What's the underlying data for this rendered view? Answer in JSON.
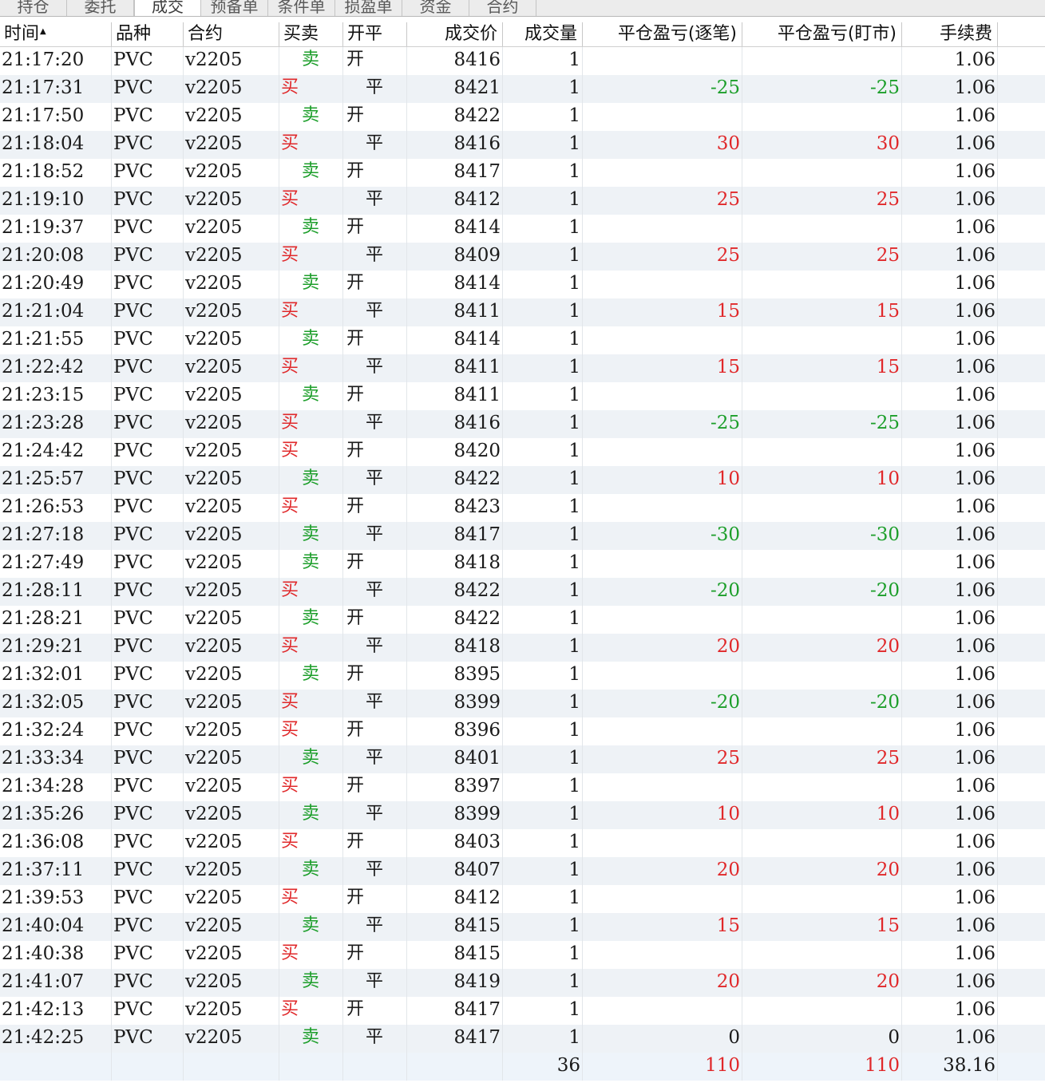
{
  "colors": {
    "buy": "#e0282a",
    "sell": "#1c9e2a",
    "profit": "#e0282a",
    "loss": "#1c9e2a",
    "row_alt": "#eef2f6"
  },
  "tabs": [
    "持仓",
    "委托",
    "成交",
    "预备单",
    "条件单",
    "损盈单",
    "资金",
    "合约"
  ],
  "active_tab": "成交",
  "sort_indicator": "▲",
  "columns": [
    "时间",
    "品种",
    "合约",
    "买卖",
    "开平",
    "成交价",
    "成交量",
    "平仓盈亏(逐笔)",
    "平仓盈亏(盯市)",
    "手续费"
  ],
  "rows": [
    {
      "time": "21:17:20",
      "product": "PVC",
      "contract": "v2205",
      "side": "卖",
      "oc": "开",
      "price": "8416",
      "qty": "1",
      "pnl_trade": "",
      "pnl_mark": "",
      "fee": "1.06"
    },
    {
      "time": "21:17:31",
      "product": "PVC",
      "contract": "v2205",
      "side": "买",
      "oc": "平",
      "price": "8421",
      "qty": "1",
      "pnl_trade": "-25",
      "pnl_mark": "-25",
      "fee": "1.06"
    },
    {
      "time": "21:17:50",
      "product": "PVC",
      "contract": "v2205",
      "side": "卖",
      "oc": "开",
      "price": "8422",
      "qty": "1",
      "pnl_trade": "",
      "pnl_mark": "",
      "fee": "1.06"
    },
    {
      "time": "21:18:04",
      "product": "PVC",
      "contract": "v2205",
      "side": "买",
      "oc": "平",
      "price": "8416",
      "qty": "1",
      "pnl_trade": "30",
      "pnl_mark": "30",
      "fee": "1.06"
    },
    {
      "time": "21:18:52",
      "product": "PVC",
      "contract": "v2205",
      "side": "卖",
      "oc": "开",
      "price": "8417",
      "qty": "1",
      "pnl_trade": "",
      "pnl_mark": "",
      "fee": "1.06"
    },
    {
      "time": "21:19:10",
      "product": "PVC",
      "contract": "v2205",
      "side": "买",
      "oc": "平",
      "price": "8412",
      "qty": "1",
      "pnl_trade": "25",
      "pnl_mark": "25",
      "fee": "1.06"
    },
    {
      "time": "21:19:37",
      "product": "PVC",
      "contract": "v2205",
      "side": "卖",
      "oc": "开",
      "price": "8414",
      "qty": "1",
      "pnl_trade": "",
      "pnl_mark": "",
      "fee": "1.06"
    },
    {
      "time": "21:20:08",
      "product": "PVC",
      "contract": "v2205",
      "side": "买",
      "oc": "平",
      "price": "8409",
      "qty": "1",
      "pnl_trade": "25",
      "pnl_mark": "25",
      "fee": "1.06"
    },
    {
      "time": "21:20:49",
      "product": "PVC",
      "contract": "v2205",
      "side": "卖",
      "oc": "开",
      "price": "8414",
      "qty": "1",
      "pnl_trade": "",
      "pnl_mark": "",
      "fee": "1.06"
    },
    {
      "time": "21:21:04",
      "product": "PVC",
      "contract": "v2205",
      "side": "买",
      "oc": "平",
      "price": "8411",
      "qty": "1",
      "pnl_trade": "15",
      "pnl_mark": "15",
      "fee": "1.06"
    },
    {
      "time": "21:21:55",
      "product": "PVC",
      "contract": "v2205",
      "side": "卖",
      "oc": "开",
      "price": "8414",
      "qty": "1",
      "pnl_trade": "",
      "pnl_mark": "",
      "fee": "1.06"
    },
    {
      "time": "21:22:42",
      "product": "PVC",
      "contract": "v2205",
      "side": "买",
      "oc": "平",
      "price": "8411",
      "qty": "1",
      "pnl_trade": "15",
      "pnl_mark": "15",
      "fee": "1.06"
    },
    {
      "time": "21:23:15",
      "product": "PVC",
      "contract": "v2205",
      "side": "卖",
      "oc": "开",
      "price": "8411",
      "qty": "1",
      "pnl_trade": "",
      "pnl_mark": "",
      "fee": "1.06"
    },
    {
      "time": "21:23:28",
      "product": "PVC",
      "contract": "v2205",
      "side": "买",
      "oc": "平",
      "price": "8416",
      "qty": "1",
      "pnl_trade": "-25",
      "pnl_mark": "-25",
      "fee": "1.06"
    },
    {
      "time": "21:24:42",
      "product": "PVC",
      "contract": "v2205",
      "side": "买",
      "oc": "开",
      "price": "8420",
      "qty": "1",
      "pnl_trade": "",
      "pnl_mark": "",
      "fee": "1.06"
    },
    {
      "time": "21:25:57",
      "product": "PVC",
      "contract": "v2205",
      "side": "卖",
      "oc": "平",
      "price": "8422",
      "qty": "1",
      "pnl_trade": "10",
      "pnl_mark": "10",
      "fee": "1.06"
    },
    {
      "time": "21:26:53",
      "product": "PVC",
      "contract": "v2205",
      "side": "买",
      "oc": "开",
      "price": "8423",
      "qty": "1",
      "pnl_trade": "",
      "pnl_mark": "",
      "fee": "1.06"
    },
    {
      "time": "21:27:18",
      "product": "PVC",
      "contract": "v2205",
      "side": "卖",
      "oc": "平",
      "price": "8417",
      "qty": "1",
      "pnl_trade": "-30",
      "pnl_mark": "-30",
      "fee": "1.06"
    },
    {
      "time": "21:27:49",
      "product": "PVC",
      "contract": "v2205",
      "side": "卖",
      "oc": "开",
      "price": "8418",
      "qty": "1",
      "pnl_trade": "",
      "pnl_mark": "",
      "fee": "1.06"
    },
    {
      "time": "21:28:11",
      "product": "PVC",
      "contract": "v2205",
      "side": "买",
      "oc": "平",
      "price": "8422",
      "qty": "1",
      "pnl_trade": "-20",
      "pnl_mark": "-20",
      "fee": "1.06"
    },
    {
      "time": "21:28:21",
      "product": "PVC",
      "contract": "v2205",
      "side": "卖",
      "oc": "开",
      "price": "8422",
      "qty": "1",
      "pnl_trade": "",
      "pnl_mark": "",
      "fee": "1.06"
    },
    {
      "time": "21:29:21",
      "product": "PVC",
      "contract": "v2205",
      "side": "买",
      "oc": "平",
      "price": "8418",
      "qty": "1",
      "pnl_trade": "20",
      "pnl_mark": "20",
      "fee": "1.06"
    },
    {
      "time": "21:32:01",
      "product": "PVC",
      "contract": "v2205",
      "side": "卖",
      "oc": "开",
      "price": "8395",
      "qty": "1",
      "pnl_trade": "",
      "pnl_mark": "",
      "fee": "1.06"
    },
    {
      "time": "21:32:05",
      "product": "PVC",
      "contract": "v2205",
      "side": "买",
      "oc": "平",
      "price": "8399",
      "qty": "1",
      "pnl_trade": "-20",
      "pnl_mark": "-20",
      "fee": "1.06"
    },
    {
      "time": "21:32:24",
      "product": "PVC",
      "contract": "v2205",
      "side": "买",
      "oc": "开",
      "price": "8396",
      "qty": "1",
      "pnl_trade": "",
      "pnl_mark": "",
      "fee": "1.06"
    },
    {
      "time": "21:33:34",
      "product": "PVC",
      "contract": "v2205",
      "side": "卖",
      "oc": "平",
      "price": "8401",
      "qty": "1",
      "pnl_trade": "25",
      "pnl_mark": "25",
      "fee": "1.06"
    },
    {
      "time": "21:34:28",
      "product": "PVC",
      "contract": "v2205",
      "side": "买",
      "oc": "开",
      "price": "8397",
      "qty": "1",
      "pnl_trade": "",
      "pnl_mark": "",
      "fee": "1.06"
    },
    {
      "time": "21:35:26",
      "product": "PVC",
      "contract": "v2205",
      "side": "卖",
      "oc": "平",
      "price": "8399",
      "qty": "1",
      "pnl_trade": "10",
      "pnl_mark": "10",
      "fee": "1.06"
    },
    {
      "time": "21:36:08",
      "product": "PVC",
      "contract": "v2205",
      "side": "买",
      "oc": "开",
      "price": "8403",
      "qty": "1",
      "pnl_trade": "",
      "pnl_mark": "",
      "fee": "1.06"
    },
    {
      "time": "21:37:11",
      "product": "PVC",
      "contract": "v2205",
      "side": "卖",
      "oc": "平",
      "price": "8407",
      "qty": "1",
      "pnl_trade": "20",
      "pnl_mark": "20",
      "fee": "1.06"
    },
    {
      "time": "21:39:53",
      "product": "PVC",
      "contract": "v2205",
      "side": "买",
      "oc": "开",
      "price": "8412",
      "qty": "1",
      "pnl_trade": "",
      "pnl_mark": "",
      "fee": "1.06"
    },
    {
      "time": "21:40:04",
      "product": "PVC",
      "contract": "v2205",
      "side": "卖",
      "oc": "平",
      "price": "8415",
      "qty": "1",
      "pnl_trade": "15",
      "pnl_mark": "15",
      "fee": "1.06"
    },
    {
      "time": "21:40:38",
      "product": "PVC",
      "contract": "v2205",
      "side": "买",
      "oc": "开",
      "price": "8415",
      "qty": "1",
      "pnl_trade": "",
      "pnl_mark": "",
      "fee": "1.06"
    },
    {
      "time": "21:41:07",
      "product": "PVC",
      "contract": "v2205",
      "side": "卖",
      "oc": "平",
      "price": "8419",
      "qty": "1",
      "pnl_trade": "20",
      "pnl_mark": "20",
      "fee": "1.06"
    },
    {
      "time": "21:42:13",
      "product": "PVC",
      "contract": "v2205",
      "side": "买",
      "oc": "开",
      "price": "8417",
      "qty": "1",
      "pnl_trade": "",
      "pnl_mark": "",
      "fee": "1.06"
    },
    {
      "time": "21:42:25",
      "product": "PVC",
      "contract": "v2205",
      "side": "卖",
      "oc": "平",
      "price": "8417",
      "qty": "1",
      "pnl_trade": "0",
      "pnl_mark": "0",
      "fee": "1.06"
    }
  ],
  "totals": {
    "qty": "36",
    "pnl_trade": "110",
    "pnl_mark": "110",
    "fee": "38.16"
  }
}
